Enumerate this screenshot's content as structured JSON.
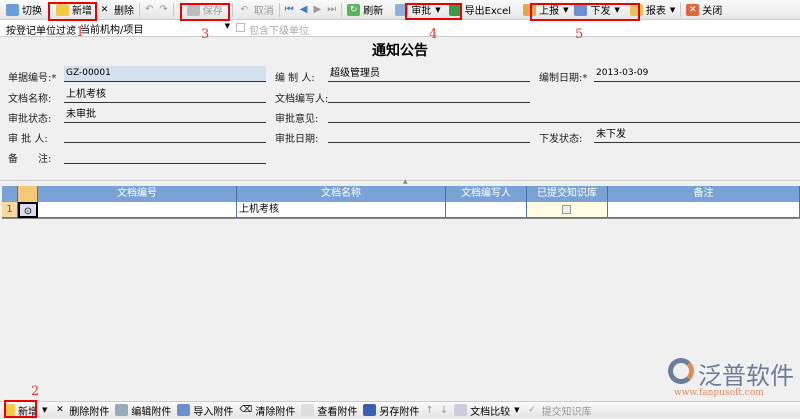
{
  "toolbar": {
    "switch": "切换",
    "add": "新增",
    "delete": "删除",
    "save": "保存",
    "cancel": "取消",
    "refresh": "刷新",
    "approve": "审批",
    "export": "导出Excel",
    "report_up": "上报",
    "issue": "下发",
    "reports": "报表",
    "close": "关闭"
  },
  "filter": {
    "label": "按登记单位过滤",
    "value": "当前机构/项目",
    "checkbox": "包含下级单位"
  },
  "title": "通知公告",
  "form": {
    "doc_no_label": "单据编号:*",
    "doc_no": "GZ-00001",
    "creator_label": "编 制 人:",
    "creator": "超级管理员",
    "date_label": "编制日期:*",
    "date": "2013-03-09",
    "name_label": "文档名称:",
    "name": "上机考核",
    "writer_label": "文档编写人:",
    "writer": "",
    "status_label": "审批状态:",
    "status": "未审批",
    "opinion_label": "审批意见:",
    "opinion": "",
    "approver_label": "审 批 人:",
    "approver": "",
    "approve_date_label": "审批日期:",
    "approve_date": "",
    "issue_status_label": "下发状态:",
    "issue_status": "未下发",
    "remark_label": "备　　注:",
    "remark": ""
  },
  "grid": {
    "headers": [
      "文档编号",
      "文档名称",
      "文档编写人",
      "已提交知识库",
      "备注"
    ],
    "rows": [
      {
        "num": "1",
        "doc_no": "",
        "name": "上机考核",
        "writer": "",
        "submitted": false,
        "remark": ""
      }
    ]
  },
  "bottom": {
    "add": "新增",
    "delete": "删除附件",
    "edit": "编辑附件",
    "import": "导入附件",
    "clear": "清除附件",
    "view": "查看附件",
    "saveas": "另存附件",
    "compare": "文档比较",
    "submit": "提交知识库"
  },
  "annotations": [
    "1",
    "2",
    "3",
    "4",
    "5"
  ],
  "logo": {
    "name": "泛普软件",
    "url": "www.fanpusoft.com"
  }
}
